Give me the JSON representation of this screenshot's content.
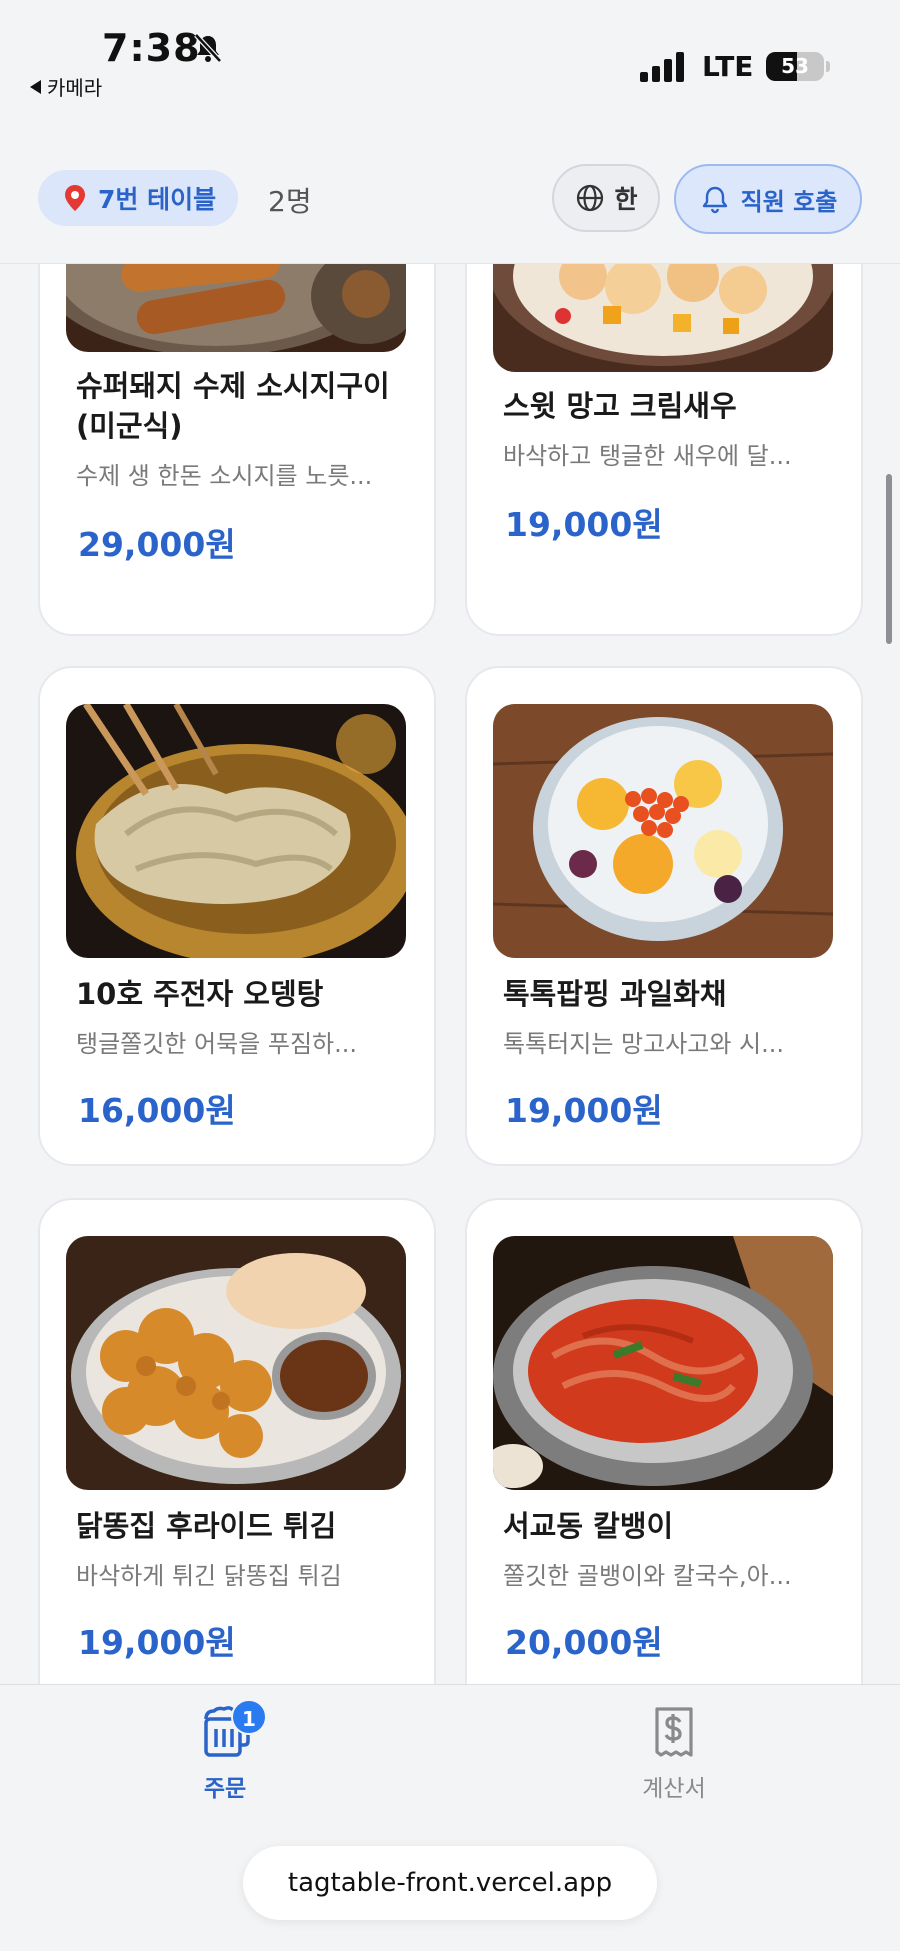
{
  "status_bar": {
    "time": "7:38",
    "back_app": "카메라",
    "network": "LTE",
    "battery_level": "53",
    "battery_fraction": 0.53
  },
  "header": {
    "table_label": "7번 테이블",
    "people_count": "2명",
    "language_label": "한",
    "call_staff_label": "직원 호출",
    "accent_color": "#2a63c9"
  },
  "menu": {
    "items": [
      {
        "name": "슈퍼돼지 수제 소시지구이 (미군식)",
        "description": "수제 생 한돈 소시지를 노릇...",
        "price": "29,000원",
        "image_icon": "grilled-sausage-photo"
      },
      {
        "name": "스윗 망고 크림새우",
        "description": "바삭하고 탱글한 새우에 달...",
        "price": "19,000원",
        "image_icon": "mango-cream-shrimp-photo"
      },
      {
        "name": "10호 주전자 오뎅탕",
        "description": "탱글쫄깃한 어묵을 푸짐하...",
        "price": "16,000원",
        "image_icon": "fishcake-soup-photo"
      },
      {
        "name": "톡톡팝핑 과일화채",
        "description": "톡톡터지는 망고사고와 시...",
        "price": "19,000원",
        "image_icon": "fruit-punch-photo"
      },
      {
        "name": "닭똥집 후라이드 튀김",
        "description": "바삭하게 튀긴 닭똥집 튀김",
        "price": "19,000원",
        "image_icon": "fried-gizzard-photo"
      },
      {
        "name": "서교동 칼뱅이",
        "description": "쫄깃한 골뱅이와 칼국수,아...",
        "price": "20,000원",
        "image_icon": "spicy-whelk-noodle-photo"
      }
    ]
  },
  "bottom_nav": {
    "order_label": "주문",
    "order_badge": "1",
    "bill_label": "계산서"
  },
  "browser": {
    "url": "tagtable-front.vercel.app"
  }
}
